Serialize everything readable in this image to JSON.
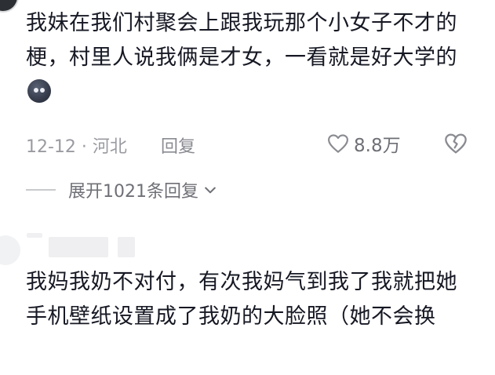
{
  "comment1": {
    "text": "我妹在我们村聚会上跟我玩那个小女子不才的梗，村里人说我俩是才女，一看就是好大学的",
    "emoji": "sly-face-emoji",
    "date_location": "12-12 · 河北",
    "reply_label": "回复",
    "like_count": "8.8万",
    "expand_label": "展开1021条回复"
  },
  "comment2": {
    "text": "我妈我奶不对付，有次我妈气到我了我就把她手机壁纸设置成了我奶的大脸照（她不会换"
  },
  "icons": {
    "like": "heart-outline-icon",
    "dislike": "broken-heart-icon",
    "expand": "chevron-down-icon"
  }
}
